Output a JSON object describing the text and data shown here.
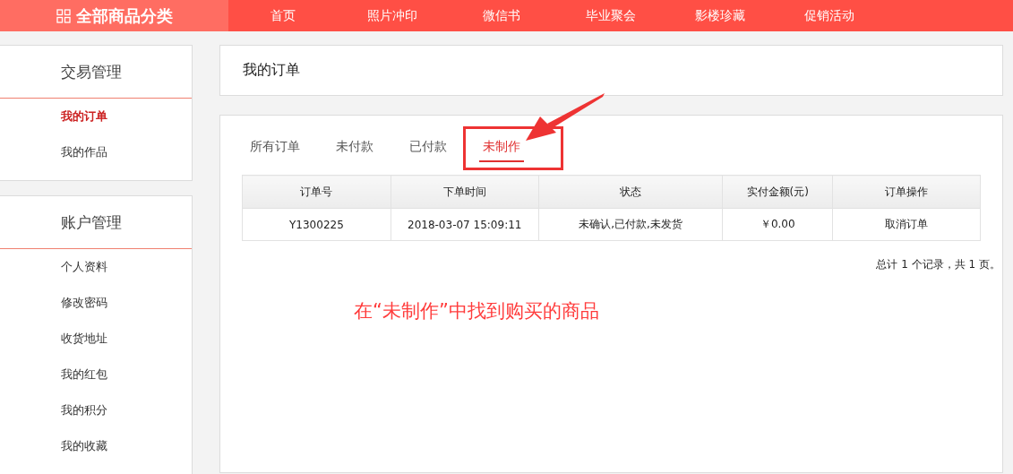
{
  "header": {
    "category_menu": "全部商品分类",
    "nav": [
      "首页",
      "照片冲印",
      "微信书",
      "毕业聚会",
      "影楼珍藏",
      "促销活动"
    ]
  },
  "sidebar": {
    "sections": [
      {
        "title": "交易管理",
        "items": [
          {
            "label": "我的订单",
            "selected": true
          },
          {
            "label": "我的作品",
            "selected": false
          }
        ]
      },
      {
        "title": "账户管理",
        "items": [
          {
            "label": "个人资料",
            "selected": false
          },
          {
            "label": "修改密码",
            "selected": false
          },
          {
            "label": "收货地址",
            "selected": false
          },
          {
            "label": "我的红包",
            "selected": false
          },
          {
            "label": "我的积分",
            "selected": false
          },
          {
            "label": "我的收藏",
            "selected": false
          }
        ]
      }
    ]
  },
  "page_title": "我的订单",
  "tabs": [
    {
      "label": "所有订单",
      "selected": false
    },
    {
      "label": "未付款",
      "selected": false
    },
    {
      "label": "已付款",
      "selected": false
    },
    {
      "label": "未制作",
      "selected": true
    }
  ],
  "table": {
    "columns": [
      "订单号",
      "下单时间",
      "状态",
      "实付金额(元)",
      "订单操作"
    ],
    "rows": [
      [
        "Y1300225",
        "2018-03-07 15:09:11",
        "未确认,已付款,未发货",
        "￥0.00",
        "取消订单"
      ]
    ]
  },
  "pagination": "总计 1 个记录，共 1 页。",
  "annotation": "在“未制作”中找到购买的商品"
}
